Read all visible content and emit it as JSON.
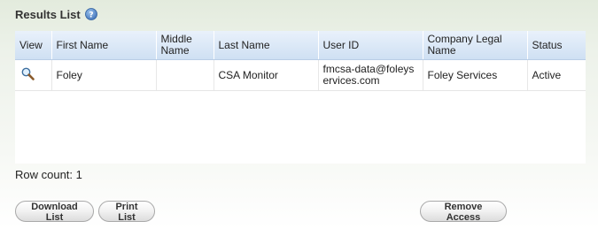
{
  "header": {
    "title": "Results List",
    "help_icon": "help-question-icon"
  },
  "table": {
    "columns": [
      "View",
      "First Name",
      "Middle Name",
      "Last Name",
      "User ID",
      "Company Legal Name",
      "Status"
    ],
    "rows": [
      {
        "view_icon": "magnifier-icon",
        "first_name": "Foley",
        "middle_name": "",
        "last_name": "CSA Monitor",
        "user_id": "fmcsa-data@foleyservices.com",
        "company": "Foley Services",
        "status": "Active"
      }
    ]
  },
  "row_count_label": "Row count: 1",
  "buttons": {
    "download": "Download List",
    "print": "Print List",
    "remove": "Remove Access"
  },
  "colors": {
    "header_bg": "#cfe0f3",
    "page_bg": "#e3ebdd",
    "help_icon": "#4a7fc0"
  }
}
